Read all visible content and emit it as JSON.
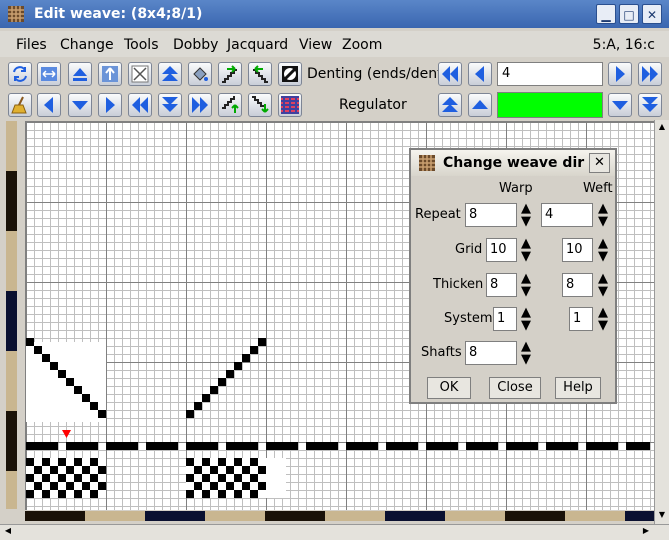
{
  "window": {
    "title": "Edit weave:  (8x4;8/1)",
    "buttons": [
      "minimize",
      "maximize",
      "close"
    ]
  },
  "menu": {
    "items": [
      "Files",
      "Change",
      "Tools",
      "Dobby",
      "Jacquard",
      "View",
      "Zoom"
    ],
    "status": "5:A,  16:c"
  },
  "toolbar": {
    "denting_label": "Denting (ends/dent)",
    "denting_value": "4",
    "regulator_label": "Regulator",
    "regulator_color": "#00ff00"
  },
  "dialog": {
    "title": "Change weave dir",
    "col_warp": "Warp",
    "col_weft": "Weft",
    "rows": [
      {
        "label": "Repeat",
        "warp": "8",
        "weft": "4"
      },
      {
        "label": "Grid",
        "warp": "10",
        "weft": "10"
      },
      {
        "label": "Thicken",
        "warp": "8",
        "weft": "8"
      },
      {
        "label": "System",
        "warp": "1",
        "weft": "1"
      },
      {
        "label": "Shafts",
        "warp": "8"
      }
    ],
    "ok": "OK",
    "close": "Close",
    "help": "Help"
  },
  "colors": {
    "accent": "#3a66b0",
    "arrow_blue": "#1f5fe0",
    "marker": "#ff0000"
  }
}
